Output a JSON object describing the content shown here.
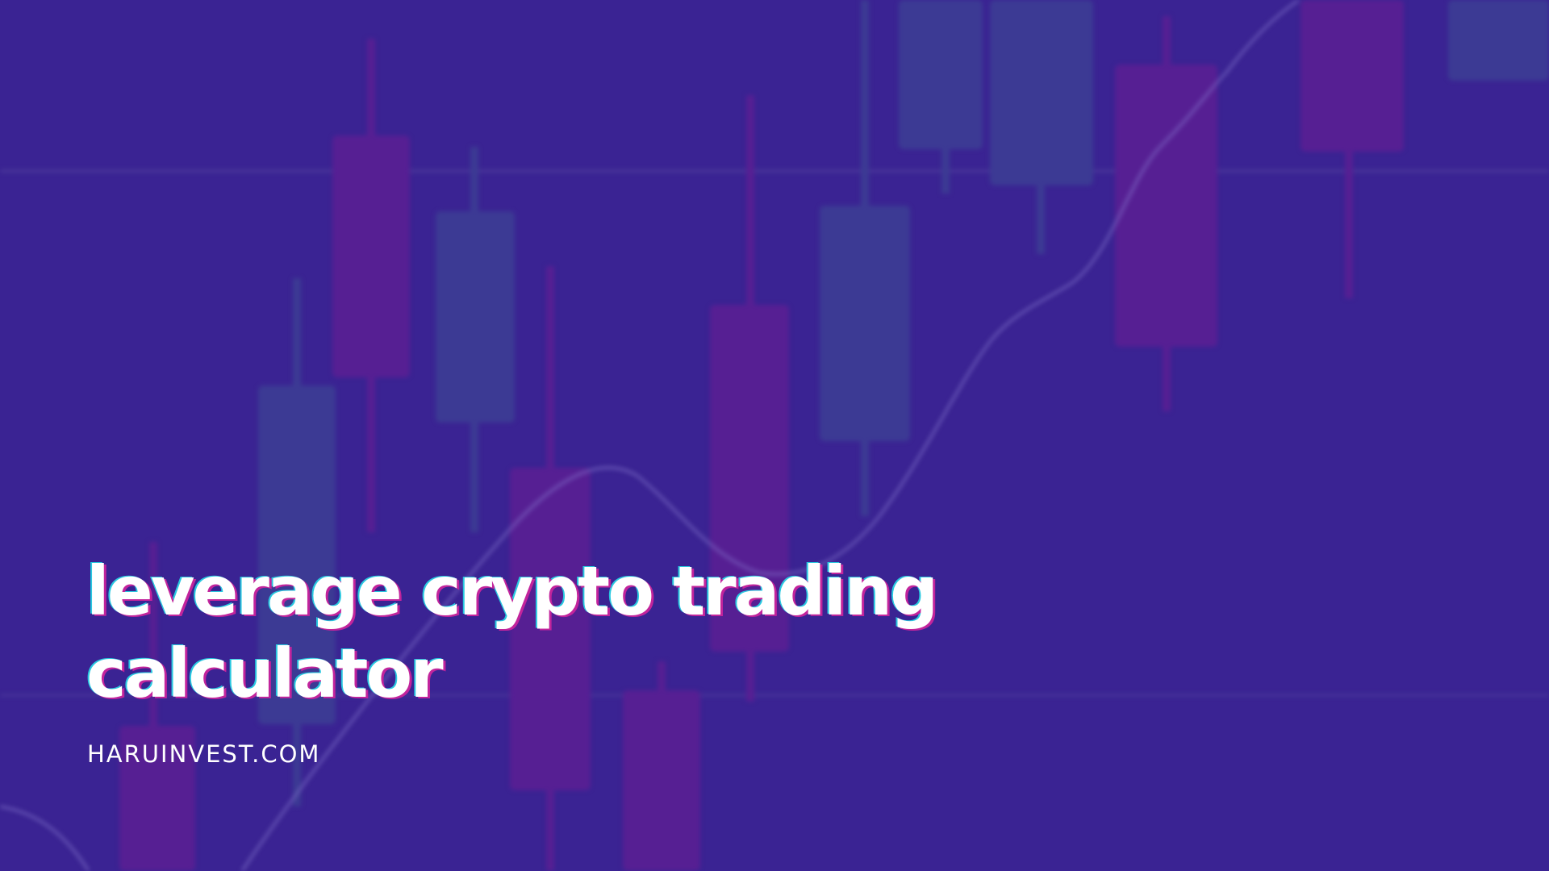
{
  "title_lines": [
    "leverage crypto trading",
    "calculator"
  ],
  "site": "HARUINVEST.COM",
  "colors": {
    "background": "#3a2393",
    "candle_up": "#3d3d95",
    "candle_down": "#5a1f94",
    "grid": "#5a4aa5",
    "trend_line": "#8a7ad0",
    "text": "#ffffff",
    "text_shadow_pink": "#c2249c",
    "text_shadow_cyan": "#29c8e0"
  }
}
